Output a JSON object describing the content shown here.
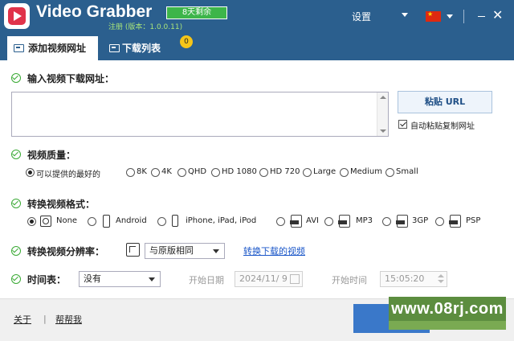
{
  "titlebar": {
    "app_name": "Video Grabber",
    "trial_badge": "8天剩余",
    "registration": "注册 (版本：1.0.0.11)",
    "settings_label": "设置"
  },
  "tabs": [
    {
      "label": "添加视频网址",
      "active": true
    },
    {
      "label": "下载列表",
      "active": false
    }
  ],
  "download_count": "0",
  "url_section": {
    "label": "输入视频下载网址：",
    "url_value": "",
    "paste_button": "粘贴 URL",
    "auto_paste_label": "自动粘贴复制网址",
    "auto_paste_checked": true
  },
  "quality": {
    "label": "视频质量：",
    "options": [
      "可以提供的最好的",
      "8K",
      "4K",
      "QHD",
      "HD 1080",
      "HD 720",
      "Large",
      "Medium",
      "Small"
    ],
    "selected": "可以提供的最好的"
  },
  "format": {
    "label": "转换视频格式：",
    "options": [
      {
        "label": "None",
        "icon": "none-icon"
      },
      {
        "label": "Android",
        "icon": "android-phone-icon"
      },
      {
        "label": "iPhone, iPad, iPod",
        "icon": "iphone-icon"
      },
      {
        "label": "AVI",
        "icon": "avi-file-icon"
      },
      {
        "label": "MP3",
        "icon": "mp3-file-icon"
      },
      {
        "label": "3GP",
        "icon": "3gp-file-icon"
      },
      {
        "label": "PSP",
        "icon": "psp-file-icon"
      }
    ],
    "selected": "None"
  },
  "resolution": {
    "label": "转换视频分辨率：",
    "value": "与原版相同",
    "convert_link": "转换下载的视频"
  },
  "schedule": {
    "label": "时间表：",
    "value": "没有",
    "start_date_label": "开始日期",
    "start_date": "2024/11/  9",
    "start_time_label": "开始时间",
    "start_time": "15:05:20"
  },
  "footer": {
    "about": "关于",
    "help": "帮帮我"
  },
  "watermark": "www.08rj.com",
  "colors": {
    "titlebar": "#2b5f8e",
    "trial_badge": "#3db54a",
    "check_green": "#3aaa35",
    "link": "#1a56c8",
    "count_badge": "#f5c518"
  }
}
